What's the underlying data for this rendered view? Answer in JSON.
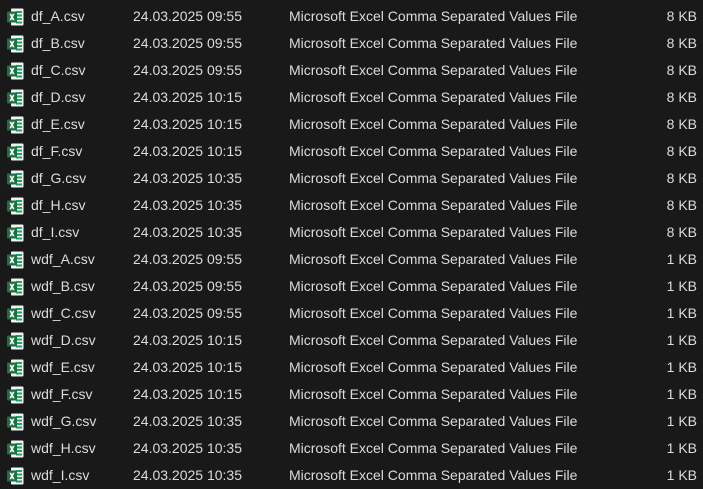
{
  "files": [
    {
      "name": "df_A.csv",
      "modified": "24.03.2025 09:55",
      "type": "Microsoft Excel Comma Separated Values File",
      "size": "8 KB",
      "icon": "excel-csv-icon"
    },
    {
      "name": "df_B.csv",
      "modified": "24.03.2025 09:55",
      "type": "Microsoft Excel Comma Separated Values File",
      "size": "8 KB",
      "icon": "excel-csv-icon"
    },
    {
      "name": "df_C.csv",
      "modified": "24.03.2025 09:55",
      "type": "Microsoft Excel Comma Separated Values File",
      "size": "8 KB",
      "icon": "excel-csv-icon"
    },
    {
      "name": "df_D.csv",
      "modified": "24.03.2025 10:15",
      "type": "Microsoft Excel Comma Separated Values File",
      "size": "8 KB",
      "icon": "excel-csv-icon"
    },
    {
      "name": "df_E.csv",
      "modified": "24.03.2025 10:15",
      "type": "Microsoft Excel Comma Separated Values File",
      "size": "8 KB",
      "icon": "excel-csv-icon"
    },
    {
      "name": "df_F.csv",
      "modified": "24.03.2025 10:15",
      "type": "Microsoft Excel Comma Separated Values File",
      "size": "8 KB",
      "icon": "excel-csv-icon"
    },
    {
      "name": "df_G.csv",
      "modified": "24.03.2025 10:35",
      "type": "Microsoft Excel Comma Separated Values File",
      "size": "8 KB",
      "icon": "excel-csv-icon"
    },
    {
      "name": "df_H.csv",
      "modified": "24.03.2025 10:35",
      "type": "Microsoft Excel Comma Separated Values File",
      "size": "8 KB",
      "icon": "excel-csv-icon"
    },
    {
      "name": "df_I.csv",
      "modified": "24.03.2025 10:35",
      "type": "Microsoft Excel Comma Separated Values File",
      "size": "8 KB",
      "icon": "excel-csv-icon"
    },
    {
      "name": "wdf_A.csv",
      "modified": "24.03.2025 09:55",
      "type": "Microsoft Excel Comma Separated Values File",
      "size": "1 KB",
      "icon": "excel-csv-icon"
    },
    {
      "name": "wdf_B.csv",
      "modified": "24.03.2025 09:55",
      "type": "Microsoft Excel Comma Separated Values File",
      "size": "1 KB",
      "icon": "excel-csv-icon"
    },
    {
      "name": "wdf_C.csv",
      "modified": "24.03.2025 09:55",
      "type": "Microsoft Excel Comma Separated Values File",
      "size": "1 KB",
      "icon": "excel-csv-icon"
    },
    {
      "name": "wdf_D.csv",
      "modified": "24.03.2025 10:15",
      "type": "Microsoft Excel Comma Separated Values File",
      "size": "1 KB",
      "icon": "excel-csv-icon"
    },
    {
      "name": "wdf_E.csv",
      "modified": "24.03.2025 10:15",
      "type": "Microsoft Excel Comma Separated Values File",
      "size": "1 KB",
      "icon": "excel-csv-icon"
    },
    {
      "name": "wdf_F.csv",
      "modified": "24.03.2025 10:15",
      "type": "Microsoft Excel Comma Separated Values File",
      "size": "1 KB",
      "icon": "excel-csv-icon"
    },
    {
      "name": "wdf_G.csv",
      "modified": "24.03.2025 10:35",
      "type": "Microsoft Excel Comma Separated Values File",
      "size": "1 KB",
      "icon": "excel-csv-icon"
    },
    {
      "name": "wdf_H.csv",
      "modified": "24.03.2025 10:35",
      "type": "Microsoft Excel Comma Separated Values File",
      "size": "1 KB",
      "icon": "excel-csv-icon"
    },
    {
      "name": "wdf_I.csv",
      "modified": "24.03.2025 10:35",
      "type": "Microsoft Excel Comma Separated Values File",
      "size": "1 KB",
      "icon": "excel-csv-icon"
    }
  ],
  "colors": {
    "background": "#191919",
    "text": "#dcdcdc",
    "excel_green": "#1d6f42",
    "excel_light": "#21a366"
  }
}
